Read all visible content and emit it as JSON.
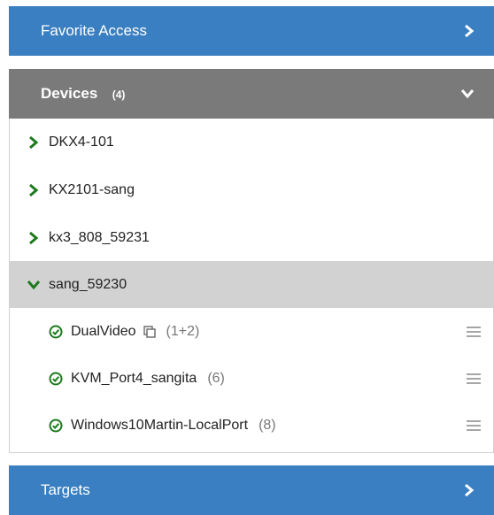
{
  "favorites": {
    "title": "Favorite Access",
    "icon": "chevron-right-icon"
  },
  "devices": {
    "title": "Devices",
    "count": "(4)",
    "icon": "chevron-down-icon",
    "items": [
      {
        "label": "DKX4-101",
        "expanded": false
      },
      {
        "label": "KX2101-sang",
        "expanded": false
      },
      {
        "label": "kx3_808_59231",
        "expanded": false
      },
      {
        "label": "sang_59230",
        "expanded": true,
        "selected": true
      }
    ],
    "ports": [
      {
        "label": "DualVideo",
        "count": "(1+2)",
        "dual": true
      },
      {
        "label": "KVM_Port4_sangita",
        "count": "(6)"
      },
      {
        "label": "Windows10Martin-LocalPort",
        "count": "(8)"
      }
    ]
  },
  "targets": {
    "title": "Targets",
    "icon": "chevron-right-icon"
  },
  "colors": {
    "blue": "#3a7fc1",
    "gray": "#7a7a7a",
    "selected": "#d2d2d2",
    "green": "#1d7a1d"
  }
}
